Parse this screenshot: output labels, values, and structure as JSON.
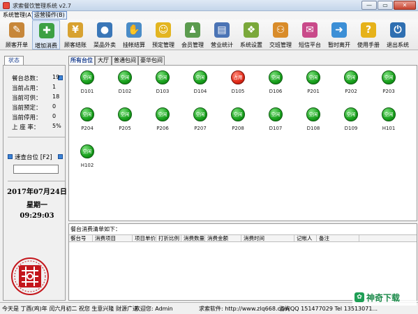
{
  "window": {
    "title": "求索餐饮管理系统 v2.7",
    "minimize": "—",
    "maximize": "▭",
    "close": "✕"
  },
  "menu": [
    {
      "label": "系统管理(A)",
      "active": false
    },
    {
      "label": "运营操作(B)",
      "active": true
    }
  ],
  "toolbar": [
    {
      "label": "顾客开单",
      "icon": "order-icon",
      "glyph": "✎",
      "color": "#c7873a"
    },
    {
      "label": "增加消费",
      "icon": "add-consume-icon",
      "glyph": "✚",
      "color": "#3da043"
    },
    {
      "label": "顾客结账",
      "icon": "checkout-icon",
      "glyph": "¥",
      "color": "#d8a230"
    },
    {
      "label": "菜品外卖",
      "icon": "takeout-icon",
      "glyph": "●",
      "color": "#3a77b8"
    },
    {
      "label": "挂帐结算",
      "icon": "credit-icon",
      "glyph": "✋",
      "color": "#4a8cc7"
    },
    {
      "label": "预定管理",
      "icon": "reserve-icon",
      "glyph": "☺",
      "color": "#e3b520"
    },
    {
      "label": "会员管理",
      "icon": "member-icon",
      "glyph": "♟",
      "color": "#5b9b4e"
    },
    {
      "label": "营业统计",
      "icon": "stats-icon",
      "glyph": "▤",
      "color": "#4b74b5"
    },
    {
      "label": "系统设置",
      "icon": "settings-icon",
      "glyph": "❖",
      "color": "#7aa83a"
    },
    {
      "label": "交班管理",
      "icon": "shift-icon",
      "glyph": "⚇",
      "color": "#d98c2a"
    },
    {
      "label": "短信平台",
      "icon": "sms-icon",
      "glyph": "✉",
      "color": "#c94a8a"
    },
    {
      "label": "暂时离开",
      "icon": "away-icon",
      "glyph": "➜",
      "color": "#3c8fd6"
    },
    {
      "label": "使用手册",
      "icon": "manual-icon",
      "glyph": "?",
      "color": "#e6b21a"
    },
    {
      "label": "退出系统",
      "icon": "exit-icon",
      "glyph": "⏻",
      "color": "#2f6fb1"
    }
  ],
  "status_panel": {
    "tab": "状态",
    "stats": [
      {
        "label": "餐台总数：",
        "value": "19"
      },
      {
        "label": "当前占用：",
        "value": "1"
      },
      {
        "label": "当前可供：",
        "value": "18"
      },
      {
        "label": "当前预定：",
        "value": "0"
      },
      {
        "label": "当前停用：",
        "value": "0"
      },
      {
        "label": "上 座 率：",
        "value": "5%"
      }
    ],
    "quick_label": "速查台位 [F2]",
    "quick_value": "",
    "date": "2017年07月24日",
    "weekday": "星期一",
    "time": "09:29:03"
  },
  "tabs": [
    "所有台位",
    "大厅",
    "普通包间",
    "豪华包间"
  ],
  "tables": [
    {
      "name": "D101",
      "status": "空闲"
    },
    {
      "name": "D102",
      "status": "空闲"
    },
    {
      "name": "D103",
      "status": "空闲"
    },
    {
      "name": "D104",
      "status": "空闲"
    },
    {
      "name": "D105",
      "status": "占用"
    },
    {
      "name": "D106",
      "status": "空闲"
    },
    {
      "name": "P201",
      "status": "空闲"
    },
    {
      "name": "P202",
      "status": "空闲"
    },
    {
      "name": "P203",
      "status": "空闲"
    },
    {
      "name": "P204",
      "status": "空闲"
    },
    {
      "name": "P205",
      "status": "空闲"
    },
    {
      "name": "P206",
      "status": "空闲"
    },
    {
      "name": "P207",
      "status": "空闲"
    },
    {
      "name": "P208",
      "status": "空闲"
    },
    {
      "name": "D107",
      "status": "空闲"
    },
    {
      "name": "D108",
      "status": "空闲"
    },
    {
      "name": "D109",
      "status": "空闲"
    },
    {
      "name": "H101",
      "status": "空闲"
    },
    {
      "name": "H102",
      "status": "空闲"
    }
  ],
  "detail": {
    "title": "餐台消费清单如下：",
    "columns": [
      "餐台号",
      "消费项目",
      "项目单价",
      "打折比例",
      "消费数量",
      "消费金额",
      "消费时间",
      "记帐人",
      "备注"
    ]
  },
  "statusbar": {
    "left": "今天是 丁酉(鸡)年 闰六月初二 祝您 生意兴隆 财源广进",
    "user": "欢迎您: Admin",
    "software": "求索软件: http://www.zlq668.com",
    "contact": "咨询QQ 151477029  Tel 13513071..."
  },
  "brand": {
    "badge": "✿",
    "text": "神奇下载"
  },
  "colors": {
    "free": "#18a01c",
    "occupied": "#e02a18",
    "accent": "#1a3f8f"
  }
}
